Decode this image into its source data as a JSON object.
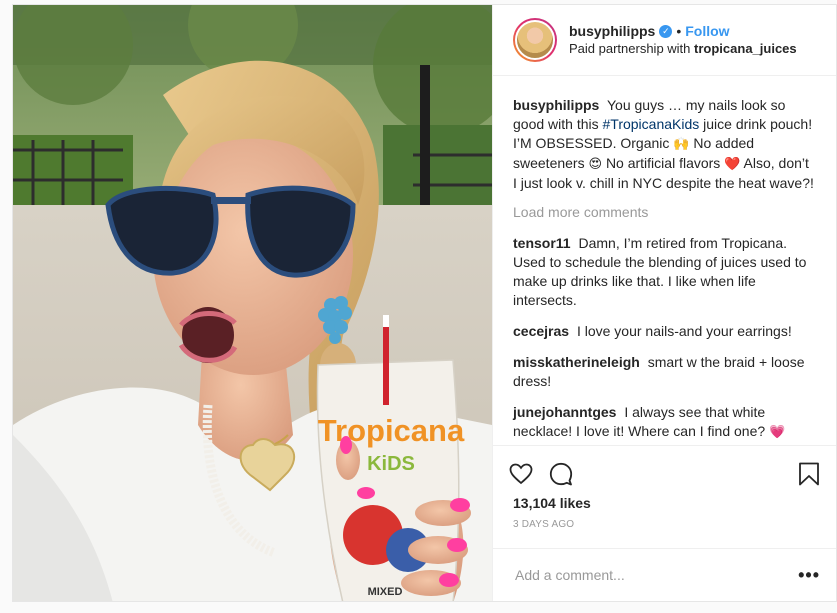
{
  "post": {
    "username": "busyphilipps",
    "verified_icon": "verified-badge-icon",
    "dot": "•",
    "follow_label": "Follow",
    "partnership_prefix": "Paid partnership with",
    "partner": "tropicana_juices",
    "caption": {
      "username": "busyphilipps",
      "text_1": "You guys … my nails look so good with this",
      "hashtag": "#TropicanaKids",
      "text_2": "juice drink pouch! I’M OBSESSED. Organic",
      "emoji_1": "🙌",
      "text_3": "No added sweeteners",
      "emoji_2": "😍",
      "text_4": "No artificial flavors",
      "emoji_3": "❤️",
      "text_5": "Also, don’t I just look v. chill in NYC despite the heat wave?!"
    },
    "load_more": "Load more comments",
    "comments": [
      {
        "user": "tensor11",
        "text": "Damn, I’m retired from Tropicana. Used to schedule the blending of juices used to make up drinks like that. I like when life intersects."
      },
      {
        "user": "cecejras",
        "text": "I love your nails-and your earrings!"
      },
      {
        "user": "misskatherineleigh",
        "text": "smart w the braid + loose dress!"
      },
      {
        "user": "junejohanntges",
        "text": "I always see that white necklace! I love it! Where can I find one?",
        "emoji": "💗"
      }
    ],
    "likes": "13,104 likes",
    "date": "3 DAYS AGO",
    "add_comment_placeholder": "Add a comment...",
    "more_label": "•••",
    "photo_labels": {
      "brand": "Tropicana",
      "line": "KiDS",
      "flavor": "MIXED"
    }
  },
  "colors": {
    "link": "#3897f0",
    "hashtag": "#003569",
    "muted": "#999999",
    "text": "#262626"
  }
}
